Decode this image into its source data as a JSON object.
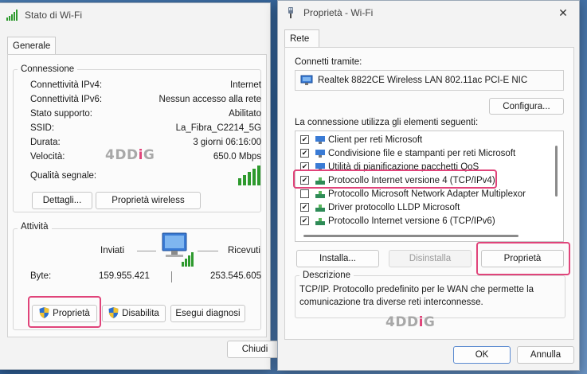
{
  "status_window": {
    "title": "Stato di Wi-Fi",
    "tab": "Generale",
    "connection_group": "Connessione",
    "rows": [
      {
        "label": "Connettività IPv4:",
        "value": "Internet"
      },
      {
        "label": "Connettività IPv6:",
        "value": "Nessun accesso alla rete"
      },
      {
        "label": "Stato supporto:",
        "value": "Abilitato"
      },
      {
        "label": "SSID:",
        "value": "La_Fibra_C2214_5G"
      },
      {
        "label": "Durata:",
        "value": "3 giorni 06:16:00"
      },
      {
        "label": "Velocità:",
        "value": "650.0 Mbps"
      }
    ],
    "signal_label": "Qualità segnale:",
    "details_button": "Dettagli...",
    "wireless_props_button": "Proprietà wireless",
    "activity_group": "Attività",
    "sent_label": "Inviati",
    "received_label": "Ricevuti",
    "bytes_label": "Byte:",
    "bytes_sent": "159.955.421",
    "bytes_received": "253.545.605",
    "properties_button": "Proprietà",
    "disable_button": "Disabilita",
    "diagnose_button": "Esegui diagnosi",
    "close_button": "Chiudi",
    "watermark": "4DDiG"
  },
  "props_window": {
    "title": "Proprietà - Wi-Fi",
    "tab": "Rete",
    "connect_using_label": "Connetti tramite:",
    "adapter": "Realtek 8822CE Wireless LAN 802.11ac PCI-E NIC",
    "configure_button": "Configura...",
    "items_label": "La connessione utilizza gli elementi seguenti:",
    "items": [
      {
        "label": "Client per reti Microsoft",
        "checked": true,
        "icon": "network-client-icon"
      },
      {
        "label": "Condivisione file e stampanti per reti Microsoft",
        "checked": true,
        "icon": "file-sharing-icon"
      },
      {
        "label": "Utilità di pianificazione pacchetti QoS",
        "checked": true,
        "icon": "qos-scheduler-icon"
      },
      {
        "label": "Protocollo Internet versione 4 (TCP/IPv4)",
        "checked": true,
        "icon": "protocol-icon"
      },
      {
        "label": "Protocollo Microsoft Network Adapter Multiplexor",
        "checked": false,
        "icon": "protocol-icon"
      },
      {
        "label": "Driver protocollo LLDP Microsoft",
        "checked": true,
        "icon": "protocol-icon"
      },
      {
        "label": "Protocollo Internet versione 6 (TCP/IPv6)",
        "checked": true,
        "icon": "protocol-icon"
      }
    ],
    "install_button": "Installa...",
    "uninstall_button": "Disinstalla",
    "properties_button": "Proprietà",
    "description_group": "Descrizione",
    "description_text_1": "TCP/IP. Protocollo predefinito per le WAN che permette la",
    "description_text_2": "comunicazione tra diverse reti interconnesse.",
    "ok_button": "OK",
    "cancel_button": "Annulla",
    "watermark": "4DDiG"
  },
  "colors": {
    "highlight": "#e0447a",
    "signal_green": "#2e9a2e",
    "shield_blue": "#2a6fd0",
    "shield_yellow": "#f2c230"
  }
}
